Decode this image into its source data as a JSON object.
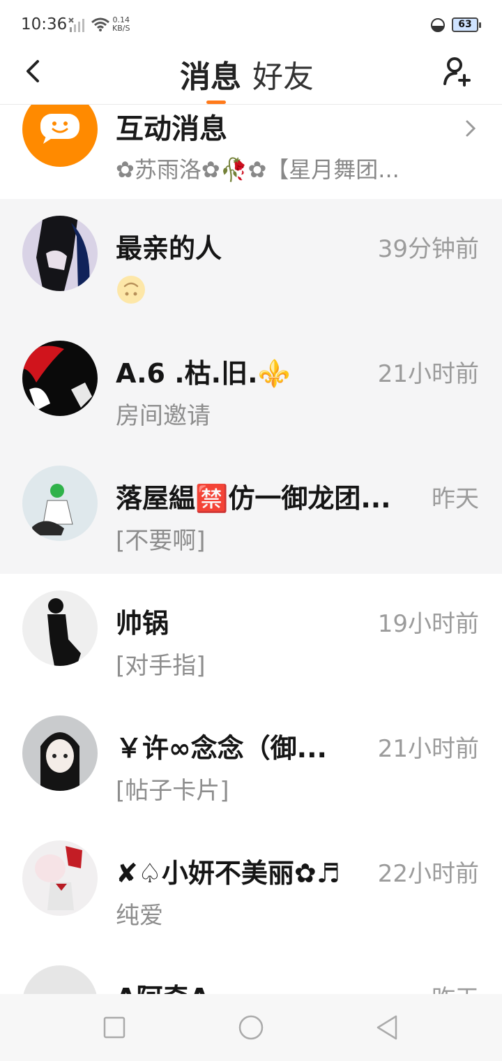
{
  "status_bar": {
    "time": "10:36",
    "speed_value": "0.14",
    "speed_unit": "KB/S",
    "battery": "63"
  },
  "header": {
    "tab_messages": "消息",
    "tab_friends": "好友",
    "accent_color": "#ff7a1a"
  },
  "interaction": {
    "title": "互动消息",
    "subtitle": "✿苏雨洛✿🥀✿【星月舞团..."
  },
  "conversations": [
    {
      "name": "最亲的人",
      "time": "39分钟前",
      "preview": "",
      "pinned": true
    },
    {
      "name": "A.6 .枯.旧.⚜️",
      "time": "21小时前",
      "preview": "房间邀请",
      "pinned": true
    },
    {
      "name": "落屋緼🈲仿一御龙团...",
      "time": "昨天",
      "preview": "[不要啊]",
      "pinned": true
    },
    {
      "name": "帅锅",
      "time": "19小时前",
      "preview": "[对手指]",
      "pinned": false
    },
    {
      "name": "￥许∞念念（御...",
      "time": "21小时前",
      "preview": "[帖子卡片]",
      "pinned": false
    },
    {
      "name": "✘♤小妍不美丽✿♬",
      "time": "22小时前",
      "preview": "纯爱",
      "pinned": false
    },
    {
      "name": "ᐱ阿奇ᐱ",
      "time": "昨天",
      "preview": "",
      "pinned": false
    }
  ]
}
